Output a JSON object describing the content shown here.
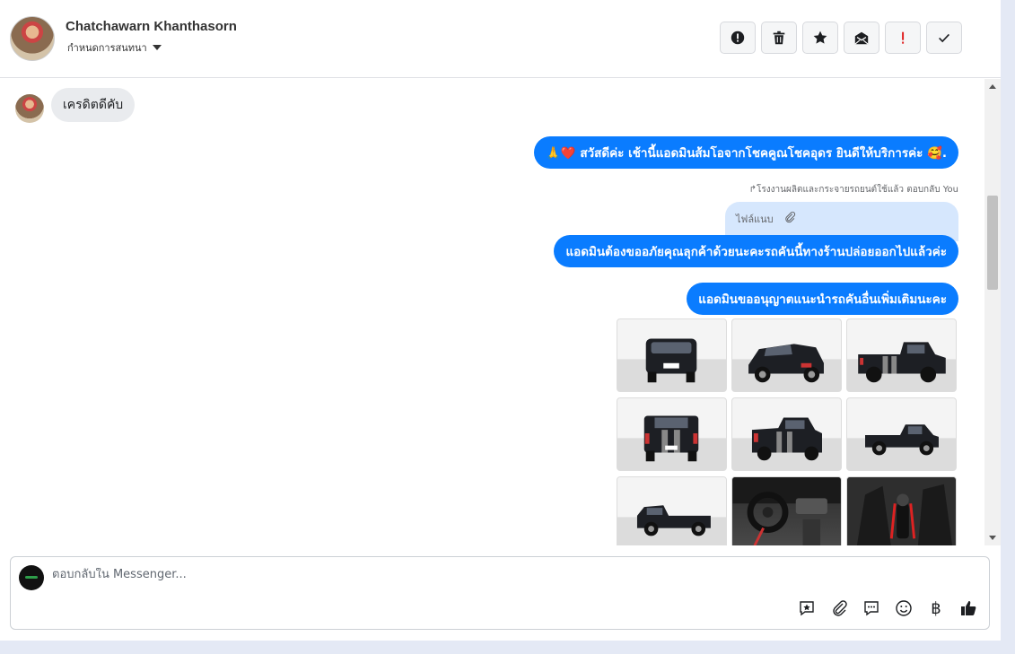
{
  "header": {
    "name": "Chatchawarn Khanthasorn",
    "assign_label": "กำหนดการสนทนา",
    "actions": [
      {
        "name": "spam-alert",
        "icon": "alert-circle-icon"
      },
      {
        "name": "delete",
        "icon": "trash-icon"
      },
      {
        "name": "star",
        "icon": "star-icon"
      },
      {
        "name": "mark-unread",
        "icon": "mail-icon"
      },
      {
        "name": "important",
        "icon": "exclamation-icon"
      },
      {
        "name": "done",
        "icon": "check-icon"
      }
    ],
    "important_color": "#e02020"
  },
  "messages": {
    "incoming_1": "เครดิตดีคับ",
    "outgoing_1": "🙏❤️ สวัสดีค่ะ เช้านี้แอดมินส้มโอจากโชคคูณโชคอุดร ยินดีให้บริการค่ะ 🥰.",
    "reply_note": "↱โรงงานผลิตและกระจายรถยนต์ใช้แล้ว ตอบกลับ You",
    "reply_quote": "ไฟล์แนบ",
    "outgoing_2": "แอดมินต้องขออภัยคุณลุกค้าด้วยนะคะรถคันนี้ทางร้านปล่อยออกไปแล้วค่ะ",
    "outgoing_3": "แอดมินขออนุญาตแนะนำรถคันอื่นเพิ่มเติมนะคะ"
  },
  "gallery": [
    {
      "name": "truck-front-photo",
      "style": "light",
      "view": "front"
    },
    {
      "name": "truck-front-three-quarter-photo",
      "style": "light",
      "view": "three-quarter"
    },
    {
      "name": "truck-rear-three-quarter-photo",
      "style": "light",
      "view": "rear-three-quarter"
    },
    {
      "name": "truck-rear-photo",
      "style": "light",
      "view": "rear"
    },
    {
      "name": "truck-rear-angle-photo",
      "style": "light",
      "view": "rear-angle"
    },
    {
      "name": "truck-side-photo",
      "style": "light",
      "view": "side"
    },
    {
      "name": "truck-side-left-photo",
      "style": "light",
      "view": "side-left"
    },
    {
      "name": "truck-interior-dashboard-photo",
      "style": "dark",
      "view": "dashboard"
    },
    {
      "name": "truck-interior-shifter-photo",
      "style": "dark",
      "view": "shifter"
    }
  ],
  "composer": {
    "placeholder": "ตอบกลับใน Messenger...",
    "tools": [
      "saved-reply-icon",
      "attach-icon",
      "chat-bubble-icon",
      "emoji-icon",
      "baht-icon",
      "thumbs-up-icon"
    ],
    "baht_symbol": "฿"
  }
}
